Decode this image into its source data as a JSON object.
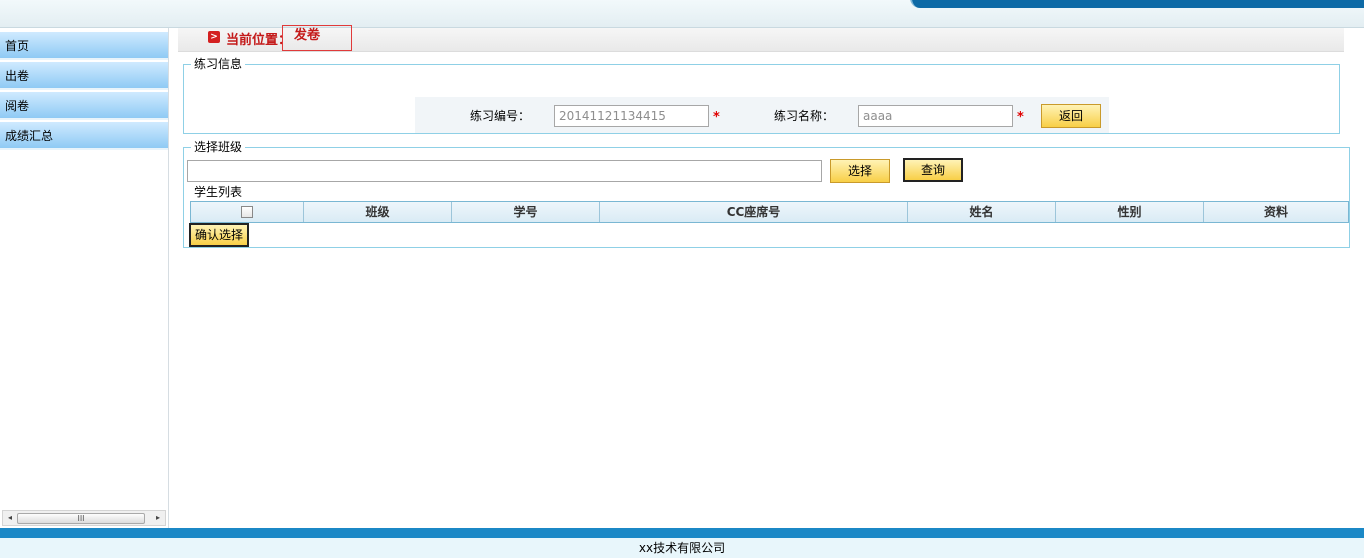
{
  "sidebar": {
    "items": [
      {
        "label": "首页"
      },
      {
        "label": "出卷"
      },
      {
        "label": "阅卷"
      },
      {
        "label": "成绩汇总"
      }
    ],
    "scroll_arrows": {
      "left": "◂",
      "right": "▸",
      "grip": "III"
    }
  },
  "breadcrumb": {
    "label": "当前位置：",
    "current": "发卷",
    "marker": ">"
  },
  "practice_info": {
    "legend": "练习信息",
    "number_label": "练习编号：",
    "number_value": "20141121134415",
    "name_label": "练习名称：",
    "name_value": "aaaa",
    "required_mark": "*",
    "back_button": "返回"
  },
  "class_select": {
    "legend": "选择班级",
    "class_input_value": "",
    "select_button": "选择",
    "query_button": "查询",
    "student_list_title": "学生列表",
    "columns": [
      "班级",
      "学号",
      "CC座席号",
      "姓名",
      "性别",
      "资料"
    ],
    "confirm_button": "确认选择"
  },
  "footer": {
    "company": "xx技术有限公司"
  },
  "colors": {
    "accent_blue": "#1b88c6",
    "button_yellow": "#f8cf47",
    "breadcrumb_red": "#c41a1a"
  }
}
